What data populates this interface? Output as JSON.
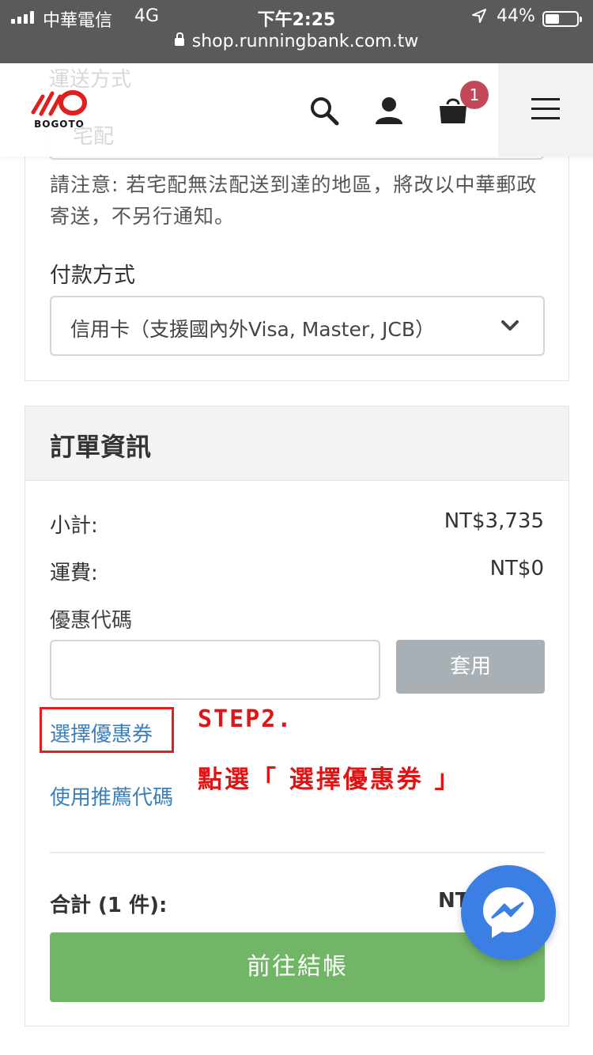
{
  "status_bar": {
    "carrier": "中華電信",
    "network": "4G",
    "time": "下午2:25",
    "battery": "44%",
    "battery_level": 0.44,
    "url": "shop.runningbank.com.tw"
  },
  "header": {
    "logo_text": "BOGOTO",
    "ghost_label": "運送方式",
    "ghost_value": "宅配",
    "cart_count": "1",
    "icons": [
      "search-icon",
      "user-icon",
      "cart-icon",
      "menu-icon"
    ]
  },
  "shipping": {
    "notice": "請注意: 若宅配無法配送到達的地區，將改以中華郵政寄送，不另行通知。"
  },
  "payment": {
    "label": "付款方式",
    "selected": "信用卡（支援國內外Visa, Master, JCB）"
  },
  "order": {
    "title": "訂單資訊",
    "subtotal_label": "小計:",
    "subtotal_value": "NT$3,735",
    "shipping_label": "運費:",
    "shipping_value": "NT$0",
    "coupon_label": "優惠代碼",
    "coupon_placeholder": "",
    "apply_label": "套用",
    "select_coupon_link": "選擇優惠券",
    "referral_link": "使用推薦代碼",
    "total_label": "合計 (1 件):",
    "total_value": "NT",
    "checkout_label": "前往結帳"
  },
  "annotation": {
    "step": "STEP2.",
    "instruction": "點選「 選擇優惠券 」",
    "color": "#e01414"
  },
  "colors": {
    "status_bar": "#5a5a5a",
    "link": "#3d7fb8",
    "checkout": "#71b566",
    "apply_button": "#a8b0b6",
    "badge": "#c2475a",
    "messenger": "#3b7fe5"
  }
}
